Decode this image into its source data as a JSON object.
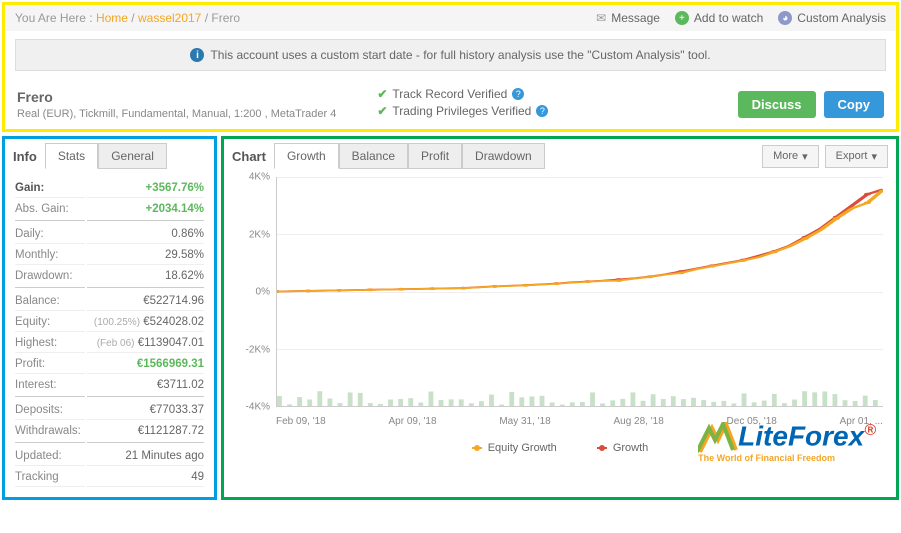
{
  "breadcrumb": {
    "prefix": "You Are Here :",
    "home": "Home",
    "user": "wassel2017",
    "current": "Frero"
  },
  "header_actions": {
    "message": "Message",
    "add_watch": "Add to watch",
    "custom_analysis": "Custom Analysis"
  },
  "notice": "This account uses a custom start date - for full history analysis use the \"Custom Analysis\" tool.",
  "account": {
    "name": "Frero",
    "details": "Real (EUR), Tickmill, Fundamental, Manual, 1:200 , MetaTrader 4",
    "track_record": "Track Record Verified",
    "trading_priv": "Trading Privileges Verified",
    "discuss_btn": "Discuss",
    "copy_btn": "Copy"
  },
  "info_panel": {
    "title": "Info",
    "tabs": [
      "Stats",
      "General"
    ],
    "gain_label": "Gain:",
    "gain_value": "+3567.76%",
    "abs_gain_label": "Abs. Gain:",
    "abs_gain_value": "+2034.14%",
    "rows": [
      {
        "label": "Daily:",
        "value": "0.86%"
      },
      {
        "label": "Monthly:",
        "value": "29.58%"
      },
      {
        "label": "Drawdown:",
        "value": "18.62%"
      }
    ],
    "rows2": [
      {
        "label": "Balance:",
        "value": "€522714.96"
      },
      {
        "label": "Equity:",
        "note": "(100.25%)",
        "value": "€524028.02"
      },
      {
        "label": "Highest:",
        "note": "(Feb 06)",
        "value": "€1139047.01"
      },
      {
        "label": "Profit:",
        "value": "€1566969.31",
        "green": true
      },
      {
        "label": "Interest:",
        "value": "€3711.02"
      }
    ],
    "rows3": [
      {
        "label": "Deposits:",
        "value": "€77033.37"
      },
      {
        "label": "Withdrawals:",
        "value": "€1121287.72"
      }
    ],
    "rows4": [
      {
        "label": "Updated:",
        "value": "21 Minutes ago"
      },
      {
        "label": "Tracking",
        "value": "49"
      }
    ]
  },
  "chart_panel": {
    "title": "Chart",
    "tabs": [
      "Growth",
      "Balance",
      "Profit",
      "Drawdown"
    ],
    "more_btn": "More",
    "export_btn": "Export",
    "legend_equity": "Equity Growth",
    "legend_growth": "Growth"
  },
  "chart_data": {
    "type": "line",
    "title": "",
    "xlabel": "",
    "ylabel": "",
    "ylim": [
      -4000,
      4000
    ],
    "y_ticks": [
      "4K%",
      "2K%",
      "0%",
      "-2K%",
      "-4K%"
    ],
    "x_ticks": [
      "Feb 09, '18",
      "Apr 09, '18",
      "May 31, '18",
      "Aug 28, '18",
      "Dec 05, '18",
      "Apr 01, ..."
    ],
    "series": [
      {
        "name": "Growth",
        "color": "#d94d3a",
        "values": [
          0,
          10,
          20,
          30,
          40,
          50,
          60,
          70,
          80,
          90,
          100,
          110,
          120,
          150,
          180,
          200,
          220,
          250,
          280,
          320,
          350,
          380,
          420,
          460,
          520,
          600,
          700,
          800,
          900,
          1000,
          1100,
          1250,
          1400,
          1600,
          1900,
          2200,
          2600,
          3000,
          3400,
          3567
        ]
      },
      {
        "name": "Equity Growth",
        "color": "#f5a623",
        "values": [
          0,
          8,
          18,
          28,
          38,
          48,
          58,
          68,
          78,
          88,
          98,
          108,
          115,
          145,
          175,
          195,
          215,
          240,
          270,
          310,
          340,
          370,
          380,
          450,
          510,
          590,
          650,
          780,
          880,
          980,
          1080,
          1200,
          1380,
          1580,
          1850,
          2150,
          2550,
          2900,
          3100,
          3550
        ]
      }
    ]
  },
  "watermark": {
    "brand": "LiteForex",
    "tagline": "The World of Financial Freedom"
  }
}
